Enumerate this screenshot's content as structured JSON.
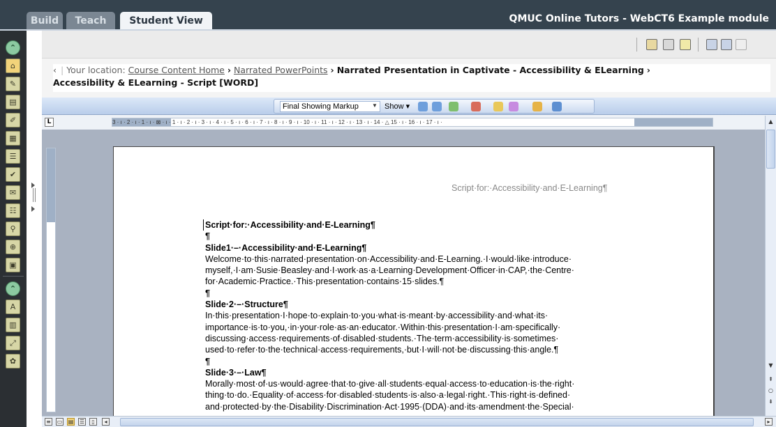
{
  "tabs": [
    "Build",
    "Teach",
    "Student View"
  ],
  "module_title": "QMUC Online Tutors - WebCT6 Example module",
  "breadcrumb": {
    "back_glyph": "‹",
    "label": "Your location:",
    "link1": "Course Content Home",
    "link2": "Narrated PowerPoints",
    "sep": "›",
    "current_line1": "Narrated Presentation in Captivate - Accessibility & ELearning",
    "current_line2": "Accessibility & ELearning - Script [WORD]"
  },
  "word_toolbar": {
    "markup_select": "Final Showing Markup",
    "show_label": "Show ▾"
  },
  "ruler": {
    "tab_selector": "L",
    "h_text": "3 · ı · 2 · ı · 1 · ı · ⊠ · ı · 1 · ı · 2 · ı · 3 · ı · 4 · ı · 5 · ı · 6 · ı · 7 · ı · 8 · ı · 9 · ı · 10 · ı · 11 · ı · 12 · ı · 13 · ı · 14 · △ 15 · ı · 16 · ı · 17 · ı ·"
  },
  "document": {
    "header": "Script·for:·Accessibility·and·E-Learning¶",
    "paragraphs": [
      {
        "text": "Script·for:·Accessibility·and·E-Learning¶",
        "bold": true
      },
      {
        "text": "¶",
        "bold": true
      },
      {
        "text": "Slide1·–·Accessibility·and·E-Learning¶",
        "bold": true
      },
      {
        "text": "Welcome·to·this·narrated·presentation·on·Accessibility·and·E-Learning.·I·would·like·introduce·",
        "bold": false
      },
      {
        "text": "myself,·I·am·Susie·Beasley·and·I·work·as·a·Learning·Development·Officer·in·CAP,·the·Centre·",
        "bold": false
      },
      {
        "text": "for·Academic·Practice.·This·presentation·contains·15·slides.¶",
        "bold": false
      },
      {
        "text": "¶",
        "bold": true
      },
      {
        "text": "Slide·2·–·Structure¶",
        "bold": true
      },
      {
        "text": "In·this·presentation·I·hope·to·explain·to·you·what·is·meant·by·accessibility·and·what·its·",
        "bold": false
      },
      {
        "text": "importance·is·to·you,·in·your·role·as·an·educator.·Within·this·presentation·I·am·specifically·",
        "bold": false
      },
      {
        "text": "discussing·access·requirements·of·disabled·students.·The·term·accessibility·is·sometimes·",
        "bold": false
      },
      {
        "text": "used·to·refer·to·the·technical·access·requirements,·but·I·will·not·be·discussing·this·angle.¶",
        "bold": false
      },
      {
        "text": "¶",
        "bold": true
      },
      {
        "text": "Slide·3·–·Law¶",
        "bold": true
      },
      {
        "text": "Morally·most·of·us·would·agree·that·to·give·all·students·equal·access·to·education·is·the·right·",
        "bold": false
      },
      {
        "text": "thing·to·do.·Equality·of·access·for·disabled·students·is·also·a·legal·right.·This·right·is·defined·",
        "bold": false
      },
      {
        "text": "and·protected·by·the·Disability·Discrimination·Act·1995·(DDA)·and·its·amendment·the·Special·",
        "bold": false
      }
    ]
  }
}
